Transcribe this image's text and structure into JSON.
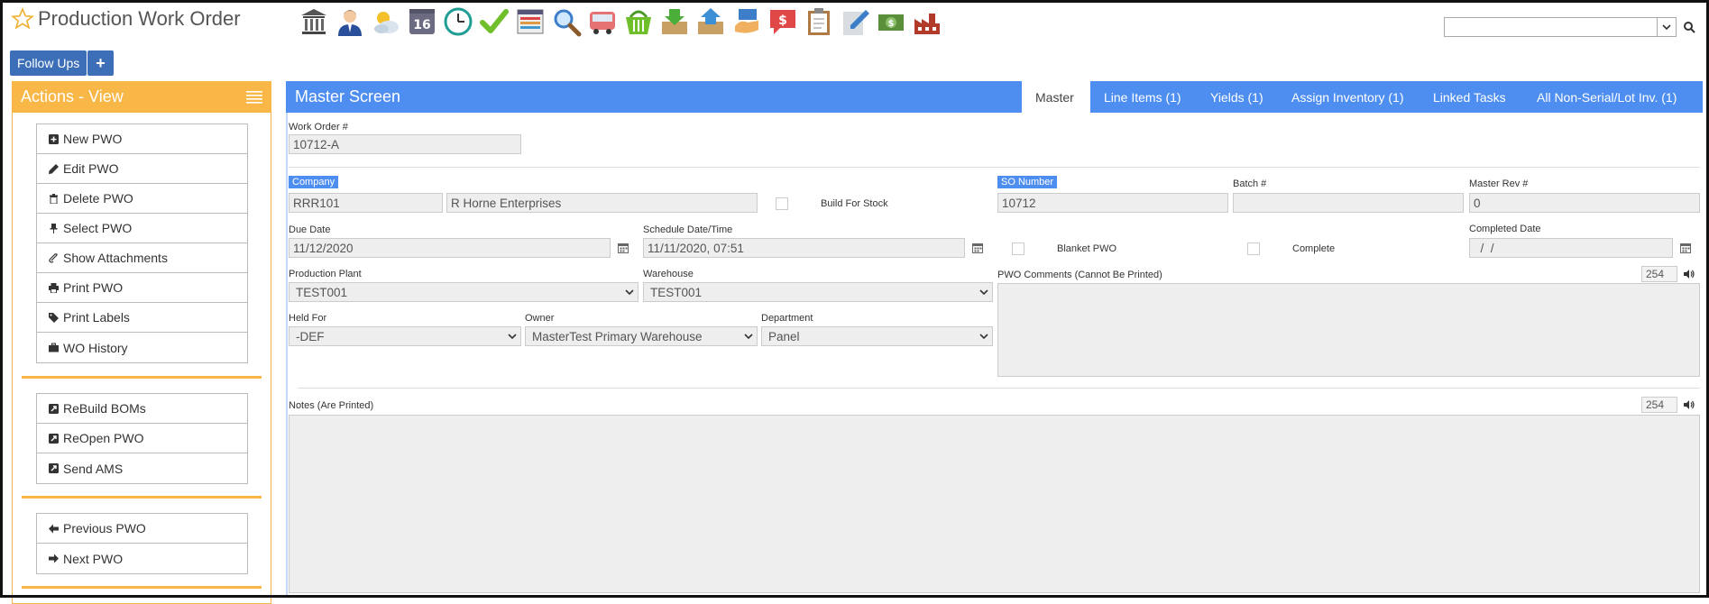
{
  "header": {
    "title": "Production Work Order"
  },
  "toolbar": {
    "icons": [
      "bank-icon",
      "person-icon",
      "weather-icon",
      "calendar-16-icon",
      "clock-icon",
      "checkmark-icon",
      "list-window-icon",
      "magnifier-icon",
      "bus-icon",
      "basket-icon",
      "inbox-download-icon",
      "box-upload-icon",
      "hand-card-icon",
      "dollar-chat-icon",
      "clipboard-icon",
      "pencil-paper-icon",
      "money-icon",
      "factory-icon"
    ],
    "calendar_day": "16"
  },
  "top_buttons": {
    "follow_ups": "Follow Ups",
    "plus": "+"
  },
  "actions": {
    "title": "Actions - View",
    "group1": [
      "New PWO",
      "Edit PWO",
      "Delete PWO",
      "Select PWO",
      "Show Attachments",
      "Print PWO",
      "Print Labels",
      "WO History"
    ],
    "group2": [
      "ReBuild BOMs",
      "ReOpen PWO",
      "Send AMS"
    ],
    "group3": [
      "Previous PWO",
      "Next PWO"
    ]
  },
  "master": {
    "title": "Master Screen",
    "tabs": [
      "Master",
      "Line Items (1)",
      "Yields (1)",
      "Assign Inventory (1)",
      "Linked Tasks",
      "All Non-Serial/Lot Inv. (1)"
    ],
    "active_tab": "Master"
  },
  "form": {
    "work_order_label": "Work Order #",
    "work_order": "10712-A",
    "company_label": "Company",
    "company_code": "RRR101",
    "company_name": "R Horne Enterprises",
    "build_for_stock_label": "Build For Stock",
    "so_number_label": "SO Number",
    "so_number": "10712",
    "batch_label": "Batch #",
    "batch": "",
    "master_rev_label": "Master Rev #",
    "master_rev": "0",
    "due_date_label": "Due Date",
    "due_date": "11/12/2020",
    "schedule_label": "Schedule Date/Time",
    "schedule": "11/11/2020, 07:51",
    "blanket_label": "Blanket PWO",
    "complete_label": "Complete",
    "completed_date_label": "Completed Date",
    "completed_date": "  /  /",
    "plant_label": "Production Plant",
    "plant": "TEST001",
    "warehouse_label": "Warehouse",
    "warehouse": "TEST001",
    "comments_label": "PWO Comments (Cannot Be Printed)",
    "comments_count": "254",
    "held_for_label": "Held For",
    "held_for": "-DEF",
    "owner_label": "Owner",
    "owner": "MasterTest Primary Warehouse",
    "department_label": "Department",
    "department": "Panel",
    "notes_label": "Notes (Are Printed)",
    "notes_count": "254"
  },
  "colors": {
    "accent_blue": "#4e8ef0",
    "orange": "#f8b747",
    "button_blue": "#3c6fb8"
  }
}
